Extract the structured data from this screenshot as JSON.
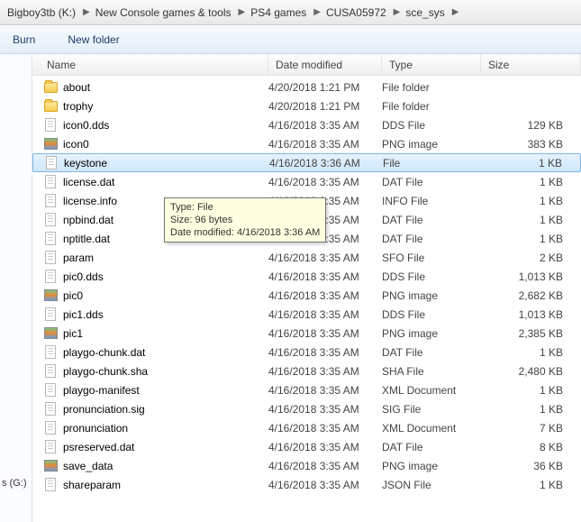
{
  "breadcrumbs": [
    "Bigboy3tb (K:)",
    "New Console games & tools",
    "PS4 games",
    "CUSA05972",
    "sce_sys"
  ],
  "toolbar": {
    "burn": "Burn",
    "newfolder": "New folder"
  },
  "columns": {
    "name": "Name",
    "date": "Date modified",
    "type": "Type",
    "size": "Size"
  },
  "tree": {
    "drive_label": "s (G:)"
  },
  "tooltip": {
    "line1": "Type: File",
    "line2": "Size: 96 bytes",
    "line3": "Date modified: 4/16/2018 3:36 AM"
  },
  "rows": [
    {
      "icon": "folder",
      "name": "about",
      "date": "4/20/2018 1:21 PM",
      "type": "File folder",
      "size": "",
      "selected": false
    },
    {
      "icon": "folder",
      "name": "trophy",
      "date": "4/20/2018 1:21 PM",
      "type": "File folder",
      "size": "",
      "selected": false
    },
    {
      "icon": "file",
      "name": "icon0.dds",
      "date": "4/16/2018 3:35 AM",
      "type": "DDS File",
      "size": "129 KB",
      "selected": false
    },
    {
      "icon": "png",
      "name": "icon0",
      "date": "4/16/2018 3:35 AM",
      "type": "PNG image",
      "size": "383 KB",
      "selected": false
    },
    {
      "icon": "file",
      "name": "keystone",
      "date": "4/16/2018 3:36 AM",
      "type": "File",
      "size": "1 KB",
      "selected": true
    },
    {
      "icon": "file",
      "name": "license.dat",
      "date": "4/16/2018 3:35 AM",
      "type": "DAT File",
      "size": "1 KB",
      "selected": false
    },
    {
      "icon": "file",
      "name": "license.info",
      "date": "4/16/2018 3:35 AM",
      "type": "INFO File",
      "size": "1 KB",
      "selected": false
    },
    {
      "icon": "file",
      "name": "npbind.dat",
      "date": "4/16/2018 3:35 AM",
      "type": "DAT File",
      "size": "1 KB",
      "selected": false
    },
    {
      "icon": "file",
      "name": "nptitle.dat",
      "date": "4/16/2018 3:35 AM",
      "type": "DAT File",
      "size": "1 KB",
      "selected": false
    },
    {
      "icon": "file",
      "name": "param",
      "date": "4/16/2018 3:35 AM",
      "type": "SFO File",
      "size": "2 KB",
      "selected": false
    },
    {
      "icon": "file",
      "name": "pic0.dds",
      "date": "4/16/2018 3:35 AM",
      "type": "DDS File",
      "size": "1,013 KB",
      "selected": false
    },
    {
      "icon": "png",
      "name": "pic0",
      "date": "4/16/2018 3:35 AM",
      "type": "PNG image",
      "size": "2,682 KB",
      "selected": false
    },
    {
      "icon": "file",
      "name": "pic1.dds",
      "date": "4/16/2018 3:35 AM",
      "type": "DDS File",
      "size": "1,013 KB",
      "selected": false
    },
    {
      "icon": "png",
      "name": "pic1",
      "date": "4/16/2018 3:35 AM",
      "type": "PNG image",
      "size": "2,385 KB",
      "selected": false
    },
    {
      "icon": "file",
      "name": "playgo-chunk.dat",
      "date": "4/16/2018 3:35 AM",
      "type": "DAT File",
      "size": "1 KB",
      "selected": false
    },
    {
      "icon": "file",
      "name": "playgo-chunk.sha",
      "date": "4/16/2018 3:35 AM",
      "type": "SHA File",
      "size": "2,480 KB",
      "selected": false
    },
    {
      "icon": "file",
      "name": "playgo-manifest",
      "date": "4/16/2018 3:35 AM",
      "type": "XML Document",
      "size": "1 KB",
      "selected": false
    },
    {
      "icon": "file",
      "name": "pronunciation.sig",
      "date": "4/16/2018 3:35 AM",
      "type": "SIG File",
      "size": "1 KB",
      "selected": false
    },
    {
      "icon": "file",
      "name": "pronunciation",
      "date": "4/16/2018 3:35 AM",
      "type": "XML Document",
      "size": "7 KB",
      "selected": false
    },
    {
      "icon": "file",
      "name": "psreserved.dat",
      "date": "4/16/2018 3:35 AM",
      "type": "DAT File",
      "size": "8 KB",
      "selected": false
    },
    {
      "icon": "png",
      "name": "save_data",
      "date": "4/16/2018 3:35 AM",
      "type": "PNG image",
      "size": "36 KB",
      "selected": false
    },
    {
      "icon": "file",
      "name": "shareparam",
      "date": "4/16/2018 3:35 AM",
      "type": "JSON File",
      "size": "1 KB",
      "selected": false
    }
  ]
}
